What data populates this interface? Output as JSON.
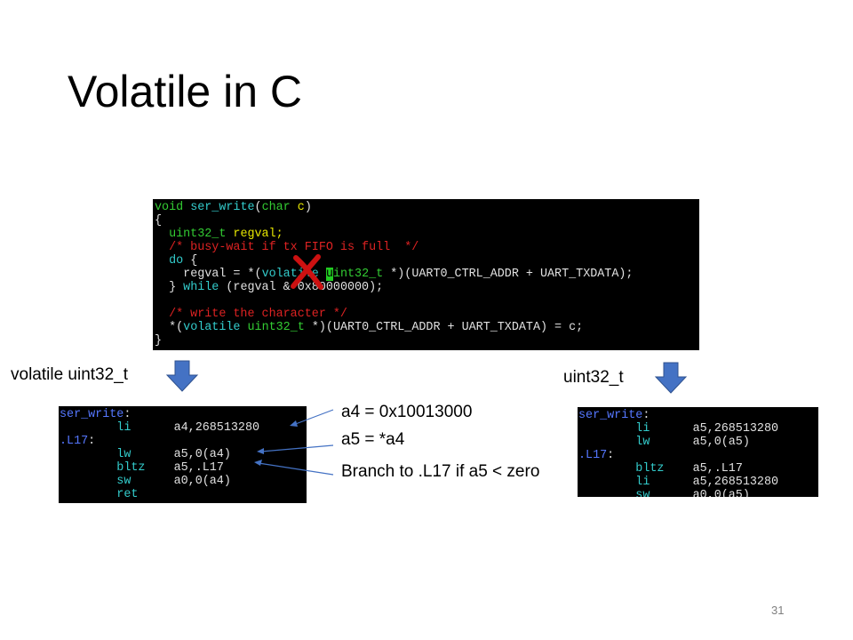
{
  "slide": {
    "title": "Volatile in C",
    "page_number": "31"
  },
  "code_c": {
    "line1": {
      "kw1": "void",
      "fn": "ser_write",
      "paren1": "(",
      "kw2": "char",
      "arg": " c",
      "paren2": ")"
    },
    "line2": "{",
    "line3": {
      "type": "uint32_t",
      "rest": " regval;"
    },
    "line4": "/* busy-wait if tx FIFO is full  */",
    "line5": {
      "kw": "do",
      "rest": " {"
    },
    "line6": {
      "pre": "regval = *(",
      "kw": "volatile",
      "cursor": "u",
      "type": "int32_t",
      "post": " *)(UART0_CTRL_ADDR + UART_TXDATA);"
    },
    "line7": {
      "pre": "} ",
      "kw": "while",
      "post": " (regval & 0x80000000);"
    },
    "line8": "/* write the character */",
    "line9": {
      "pre": "*(",
      "kw": "volatile",
      "type": "uint32_t",
      "post": " *)(UART0_CTRL_ADDR + UART_TXDATA) = c;"
    },
    "line10": "}"
  },
  "labels": {
    "left_heading": "volatile uint32_t",
    "right_heading": "uint32_t",
    "annot1": "a4 = 0x10013000",
    "annot2": "a5 = *a4",
    "annot3": "Branch to .L17 if a5 < zero"
  },
  "asm_left": {
    "fn_label": "ser_write",
    "colon": ":",
    "r1": {
      "op": "li",
      "args": "a4,268513280"
    },
    "label2": ".L17",
    "r2": {
      "op": "lw",
      "args": "a5,0(a4)"
    },
    "r3": {
      "op": "bltz",
      "args": "a5,.L17"
    },
    "r4": {
      "op": "sw",
      "args": "a0,0(a4)"
    },
    "r5": {
      "op": "ret"
    }
  },
  "asm_right": {
    "fn_label": "ser_write",
    "colon": ":",
    "r1": {
      "op": "li",
      "args": "a5,268513280"
    },
    "r2": {
      "op": "lw",
      "args": "a5,0(a5)"
    },
    "label2": ".L17",
    "r3": {
      "op": "bltz",
      "args": "a5,.L17"
    },
    "r4": {
      "op": "li",
      "args": "a5,268513280"
    },
    "r5": {
      "op": "sw",
      "args": "a0,0(a5)"
    }
  },
  "colors": {
    "arrow_fill": "#4472c4",
    "cross_mark": "#cc1111",
    "annotation_line": "#4472c4"
  },
  "icons": {
    "down_arrow": "down-arrow-icon",
    "cross": "cross-mark-icon"
  }
}
